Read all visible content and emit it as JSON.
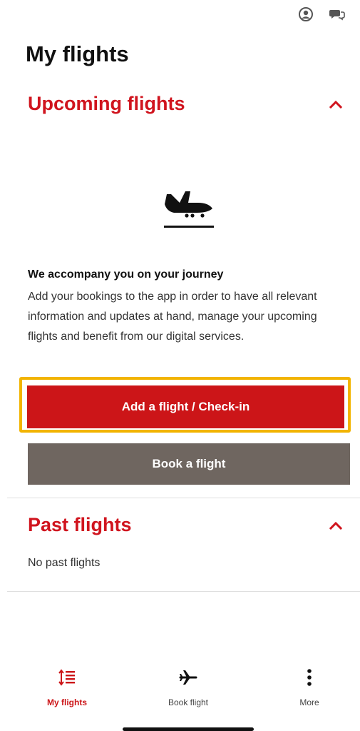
{
  "header": {
    "title": "My flights",
    "icons": [
      "account-icon",
      "chat-icon"
    ]
  },
  "upcoming": {
    "title": "Upcoming flights",
    "expanded": true,
    "illustration": "plane-landing-icon",
    "info_title": "We accompany you on your journey",
    "info_body": "Add your bookings to the app in order to have all relevant information and updates at hand, manage your upcoming flights and benefit from our digital services.",
    "add_button_label": "Add a flight / Check-in",
    "book_button_label": "Book a flight"
  },
  "past": {
    "title": "Past flights",
    "expanded": true,
    "empty_text": "No past flights"
  },
  "bottom_nav": {
    "items": [
      {
        "label": "My flights",
        "icon": "flight-list-icon",
        "active": true
      },
      {
        "label": "Book flight",
        "icon": "plane-icon",
        "active": false
      },
      {
        "label": "More",
        "icon": "more-vertical-icon",
        "active": false
      }
    ]
  },
  "colors": {
    "accent_red": "#cc1518",
    "title_red": "#d0141e",
    "secondary_button": "#6f6660",
    "focus_ring": "#f2b400"
  }
}
